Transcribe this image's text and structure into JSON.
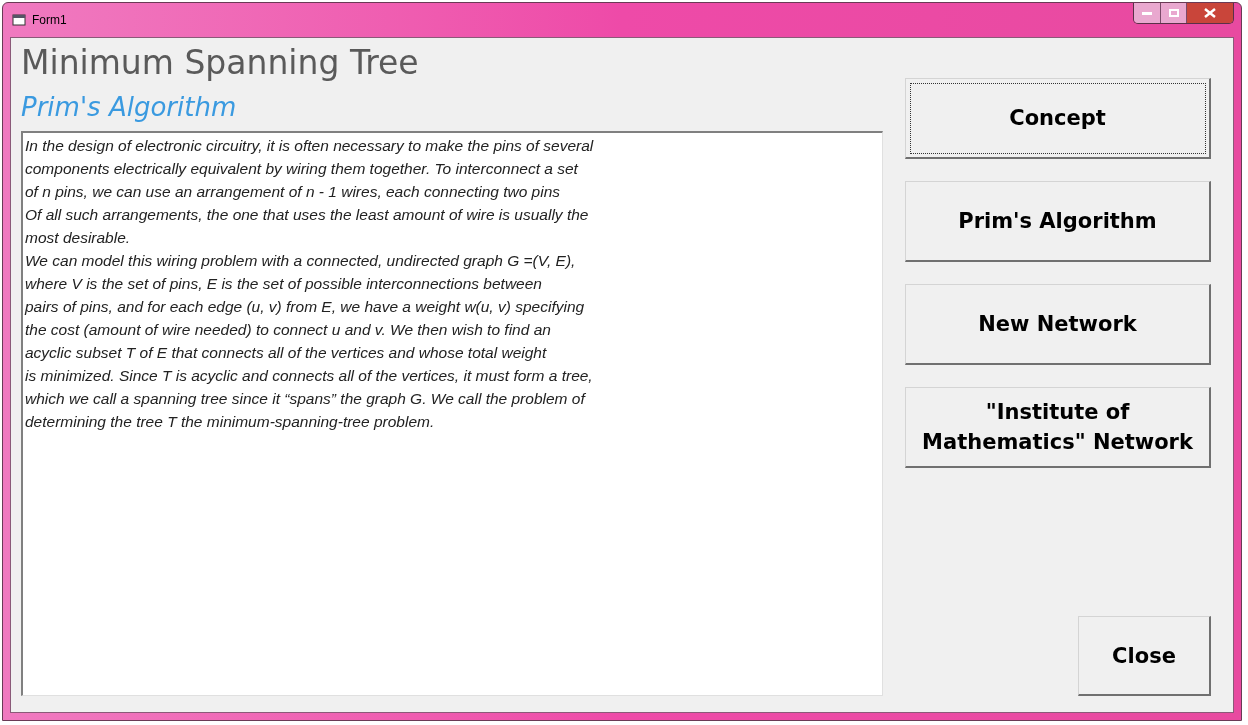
{
  "window": {
    "title": "Form1"
  },
  "heading": "Minimum Spanning Tree",
  "subheading": "Prim's Algorithm",
  "text_area": {
    "value": "In the design of electronic circuitry, it is often necessary to make the pins of several\ncomponents electrically equivalent by wiring them together. To interconnect a set\nof n pins, we can use an arrangement of n - 1 wires, each connecting two pins\nOf all such arrangements, the one that uses the least amount of wire is usually the\nmost desirable.\nWe can model this wiring problem with a connected, undirected graph G =(V, E),\nwhere V is the set of pins, E is the set of possible interconnections between\npairs of pins, and for each edge (u, v) from E, we have a weight w(u, v) specifying\nthe cost (amount of wire needed) to connect u and v. We then wish to find an\nacyclic subset T of E that connects all of the vertices and whose total weight\nis minimized. Since T is acyclic and connects all of the vertices, it must form a tree,\nwhich we call a spanning tree since it “spans” the graph G. We call the problem of\ndetermining the tree T the minimum-spanning-tree problem."
  },
  "buttons": [
    {
      "label": "Concept",
      "focused": true
    },
    {
      "label": "Prim's Algorithm",
      "focused": false
    },
    {
      "label": "New Network",
      "focused": false
    },
    {
      "label": "\"Institute of Mathematics\" Network",
      "focused": false
    }
  ],
  "close_button": {
    "label": "Close"
  }
}
